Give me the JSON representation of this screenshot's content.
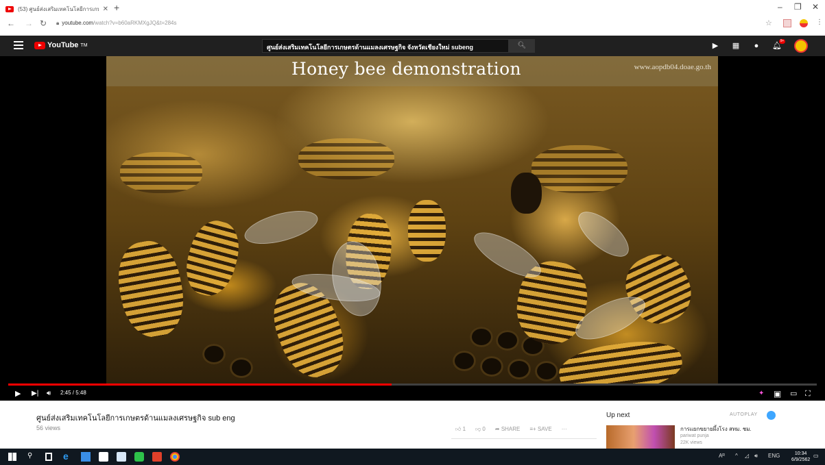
{
  "browser": {
    "tab_title": "(53) ศูนย์ส่งเสริมเทคโนโลยีการเกษตร...",
    "url_host": "youtube.com",
    "url_rest": "/watch?v=b60aRKMXgJQ&t=284s"
  },
  "youtube": {
    "logo_text": "YouTube",
    "logo_tm": "TM",
    "search_value": "ศูนย์ส่งเสริมเทคโนโลยีการเกษตรด้านแมลงเศรษฐกิจ จังหวัดเชียงใหม่ subeng",
    "notification_count": "9+"
  },
  "player": {
    "overlay_title": "Honey bee demonstration",
    "overlay_url": "www.aopdb04.doae.go.th",
    "timecode": "2:45 / 5:48",
    "progress_fraction": 0.474
  },
  "video": {
    "title": "ศูนย์ส่งเสริมเทคโนโลยีการเกษตรด้านแมลงเศรษฐกิจ sub eng",
    "views": "56 views",
    "likes": "1",
    "dislikes": "0",
    "share_label": "SHARE",
    "save_label": "SAVE",
    "more_label": "···"
  },
  "sidebar": {
    "up_next_label": "Up next",
    "autoplay_label": "AUTOPLAY",
    "recommendations": [
      {
        "title": "การแยกขยายผึ้งโรง สทม. ชม.",
        "channel": "pariwat punja",
        "views": "22K views"
      }
    ]
  },
  "taskbar": {
    "language": "ENG",
    "time": "10:34",
    "date": "6/9/2562"
  },
  "colors": {
    "yt_dark": "#202020",
    "yt_red": "#ff0000",
    "autoplay_blue": "#3ea6ff",
    "taskbar": "#101820"
  }
}
